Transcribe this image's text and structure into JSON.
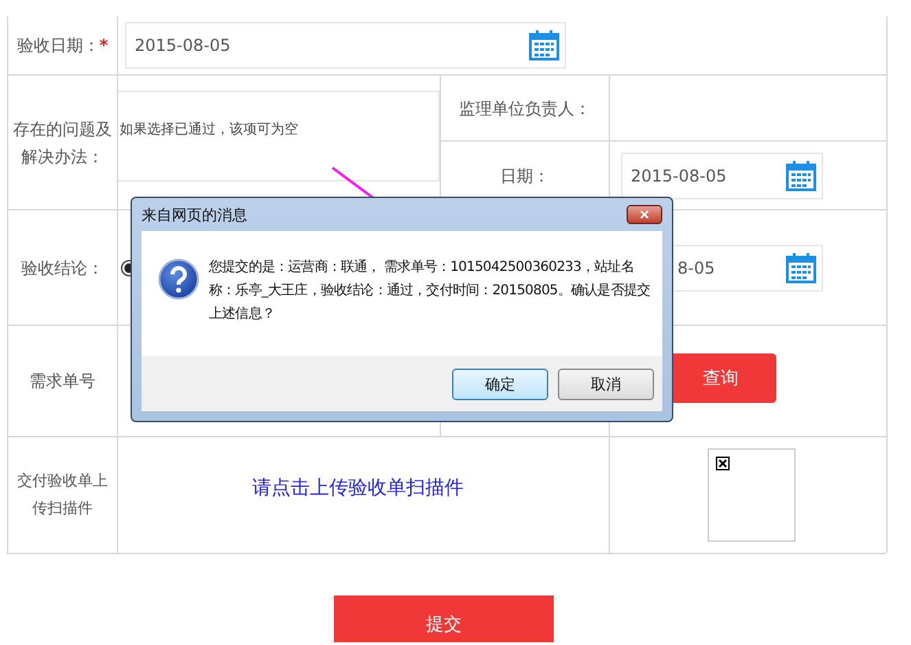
{
  "form": {
    "acceptance_date": {
      "label": "验收日期：",
      "required_mark": "*",
      "value": "2015-08-05"
    },
    "issues": {
      "label": "存在的问题及解决办法：",
      "placeholder": "如果选择已通过，该项可为空"
    },
    "supervisor": {
      "label": "监理单位负责人："
    },
    "supervisor_date": {
      "label": "日期：",
      "value": "2015-08-05"
    },
    "conclusion": {
      "label": "验收结论：",
      "radio_checked": true,
      "date_value": "8-05"
    },
    "request_no": {
      "label": "需求单号",
      "query_button": "查询"
    },
    "upload": {
      "label": "交付验收单上传扫描件",
      "link": "请点击上传验收单扫描件"
    },
    "submit_button": "提交"
  },
  "dialog": {
    "title": "来自网页的消息",
    "close": "×",
    "message": "您提交的是：运营商：联通， 需求单号：1015042500360233，站址名称：乐亭_大王庄，验收结论：通过，交付时间：20150805。确认是否提交上述信息？",
    "buttons": [
      {
        "label": "确定",
        "selected": true
      },
      {
        "label": "取消",
        "selected": false
      }
    ]
  }
}
